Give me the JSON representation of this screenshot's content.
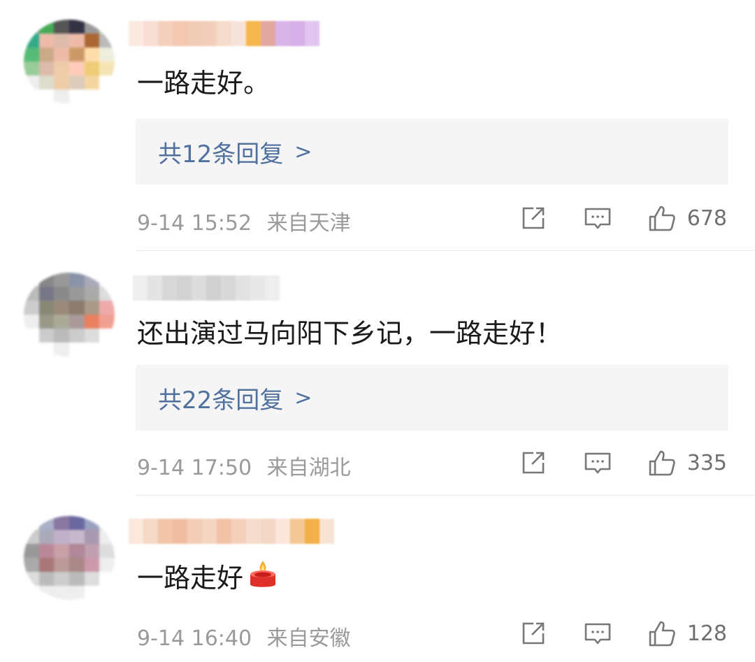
{
  "comments": [
    {
      "text": "一路走好。",
      "reply_label": "共12条回复",
      "chevron": ">",
      "date": "9-14 15:52",
      "location": "来自天津",
      "likes": "678",
      "avatar_colors": [
        "#8aa",
        "#4a5",
        "#555",
        "#334",
        "#999",
        "#cdb",
        "#3a8",
        "#eba",
        "#dba",
        "#eba",
        "#a63",
        "#bbb",
        "#5b7",
        "#ca8",
        "#eba",
        "#c96",
        "#fda",
        "#eed",
        "#9c9",
        "#dba",
        "#eca",
        "#fcb",
        "#ec7",
        "#f5e5b5",
        "#eee",
        "#ddc",
        "#eca",
        "#dcb",
        "#f4d6a0",
        "#fff",
        "#fff",
        "#fff",
        "#eee",
        "#fff",
        "#fff",
        "#fff"
      ],
      "name_colors": [
        "#fbe9e0",
        "#f8e0d4",
        "#f4d0bc",
        "#f2c8b0",
        "#f0cbb6",
        "#f3cfbb",
        "#f6dccc",
        "#f6e4da",
        "#f4b74e",
        "#e3a7a1",
        "#d9b6e8",
        "#d5afe6",
        "#e1c4ef"
      ]
    },
    {
      "text": "还出演过马向阳下乡记，一路走好！",
      "reply_label": "共22条回复",
      "chevron": ">",
      "date": "9-14 17:50",
      "location": "来自湖北",
      "likes": "335",
      "avatar_colors": [
        "#ddd",
        "#888",
        "#999",
        "#8a94a8",
        "#aab",
        "#eee",
        "#bbb",
        "#778",
        "#8a8a8a",
        "#999",
        "#aaa",
        "#ddd",
        "#ccc",
        "#887",
        "#9a8a7a",
        "#8c7c6c",
        "#a98",
        "#eaa",
        "#eee",
        "#998",
        "#aa9",
        "#a99",
        "#e98060",
        "#f0a090",
        "#fff",
        "#ccc",
        "#bbb",
        "#ccc",
        "#ddd",
        "#fff",
        "#fff",
        "#fff",
        "#eee",
        "#fff",
        "#fff",
        "#fff"
      ],
      "name_colors": [
        "#eeeeee",
        "#e4e4e4",
        "#d8d8d8",
        "#d2d2d2",
        "#dcdcdc",
        "#d0d0d0",
        "#d8d8d8",
        "#e2e2e2",
        "#e8e8e8",
        "#eeeeee"
      ]
    },
    {
      "text": "一路走好",
      "reply_label": "",
      "chevron": "",
      "date": "9-14 16:40",
      "location": "来自安徽",
      "likes": "128",
      "avatar_colors": [
        "#eee",
        "#a9b0c8",
        "#8878a0",
        "#6a68a0",
        "#9aa0c0",
        "#ddd",
        "#ccc",
        "#aab",
        "#c0b0c8",
        "#c8b8cc",
        "#a898b0",
        "#eee",
        "#999",
        "#b89",
        "#c8a0a8",
        "#b08898",
        "#c0a0b0",
        "#ddd",
        "#aaa",
        "#a77",
        "#b99",
        "#a88",
        "#c9a",
        "#eee",
        "#ddd",
        "#bbb",
        "#ccc",
        "#bbb",
        "#ddd",
        "#fff",
        "#fff",
        "#eee",
        "#eee",
        "#eee",
        "#fff",
        "#fff"
      ],
      "name_colors": [
        "#fbe7dc",
        "#f6d8c6",
        "#f2c4aa",
        "#f0bea2",
        "#f3cdb6",
        "#f5d5c2",
        "#f0c2a8",
        "#f4cfba",
        "#f6dccc",
        "#f2d6c6",
        "#fbe6da",
        "#f4c794",
        "#f4b04a",
        "#f8e4d4"
      ]
    }
  ],
  "colors": {
    "link": "#50709e",
    "meta": "#9a9a9a",
    "reply_bg": "#f5f5f5"
  },
  "icons": {
    "share": "share-icon",
    "comment": "comment-icon",
    "like": "thumbs-up-icon",
    "emoji": "candle-emoji-icon"
  }
}
